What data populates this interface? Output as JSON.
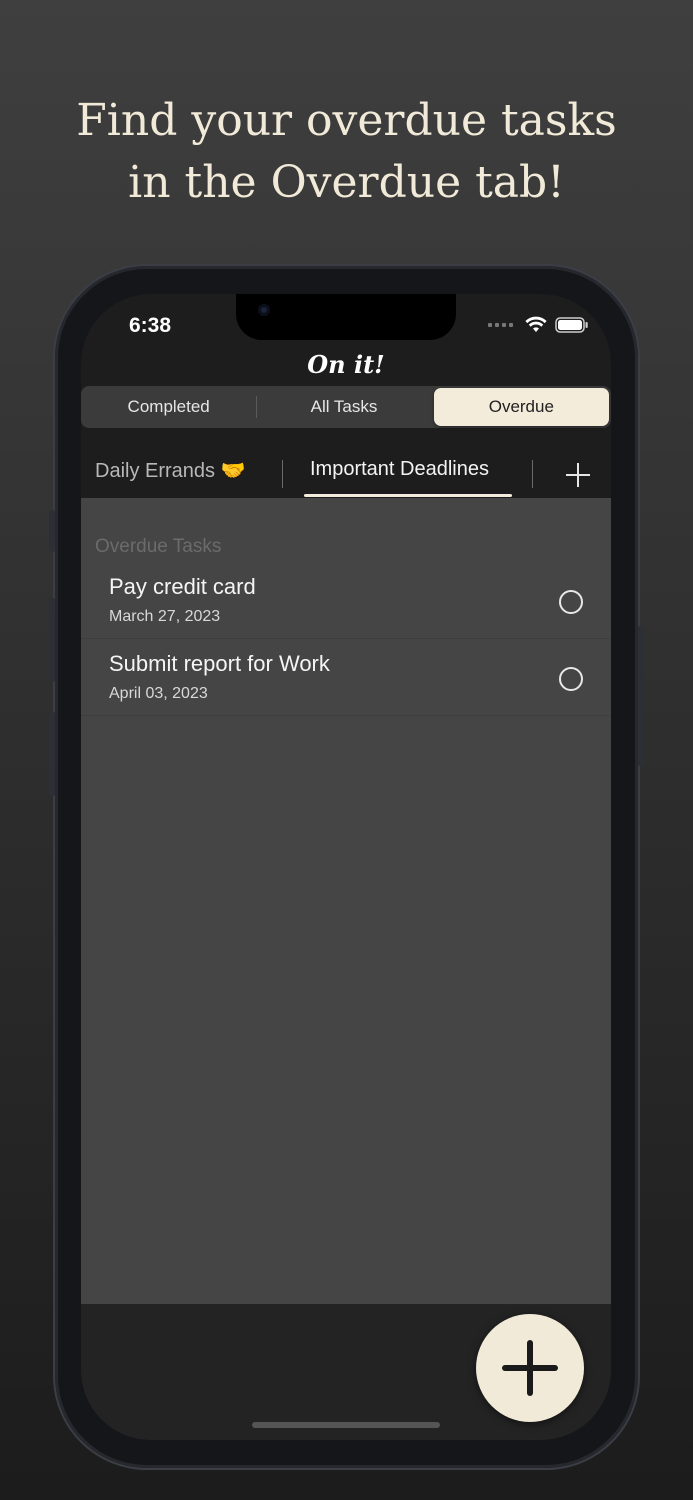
{
  "promo": {
    "line1": "Find your overdue tasks",
    "line2": "in the Overdue tab!"
  },
  "status_bar": {
    "time": "6:38",
    "icons": [
      "signal-dots-icon",
      "wifi-icon",
      "battery-icon"
    ]
  },
  "app": {
    "title": "On it!"
  },
  "segments": [
    {
      "label": "Completed",
      "selected": false
    },
    {
      "label": "All Tasks",
      "selected": false
    },
    {
      "label": "Overdue",
      "selected": true
    }
  ],
  "list_tabs": [
    {
      "label": "Daily Errands 🤝",
      "selected": false
    },
    {
      "label": "Important Deadlines",
      "selected": true
    }
  ],
  "add_list_icon": "plus-icon",
  "section": {
    "header": "Overdue Tasks",
    "tasks": [
      {
        "title": "Pay credit card",
        "date": "March 27, 2023",
        "completed": false
      },
      {
        "title": "Submit report for Work",
        "date": "April 03, 2023",
        "completed": false
      }
    ]
  },
  "fab_icon": "plus-icon",
  "colors": {
    "accent": "#f1ead8",
    "list_background": "#454545",
    "segment_background": "#3b3b3b"
  }
}
